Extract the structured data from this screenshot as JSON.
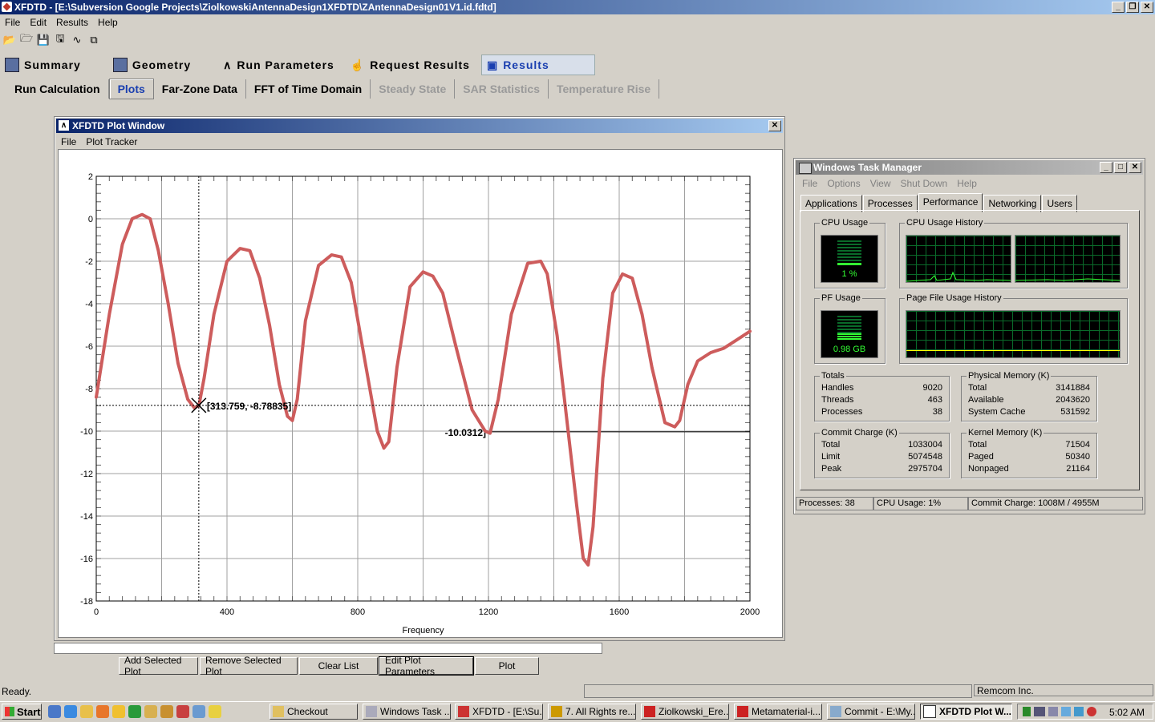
{
  "app": {
    "title": "XFDTD - [E:\\Subversion Google Projects\\ZiolkowskiAntennaDesign1XFDTD\\ZAntennaDesign01V1.id.fdtd]",
    "menus": [
      "File",
      "Edit",
      "Results",
      "Help"
    ],
    "toolbar_icons": [
      "open-icon",
      "open-folder-icon",
      "save-icon",
      "save-as-icon",
      "curve-icon",
      "copy-icon"
    ]
  },
  "main_tabs": [
    {
      "label": "Summary",
      "icon": "summary-icon"
    },
    {
      "label": "Geometry",
      "icon": "geometry-icon"
    },
    {
      "label": "Run Parameters",
      "icon": "run-parameters-icon"
    },
    {
      "label": "Request Results",
      "icon": "request-results-icon"
    },
    {
      "label": "Results",
      "icon": "results-icon",
      "active": true
    }
  ],
  "sub_tabs": [
    {
      "label": "Run Calculation",
      "state": "normal"
    },
    {
      "label": "Plots",
      "state": "active"
    },
    {
      "label": "Far-Zone Data",
      "state": "normal"
    },
    {
      "label": "FFT of Time Domain",
      "state": "normal"
    },
    {
      "label": "Steady State",
      "state": "disabled"
    },
    {
      "label": "SAR Statistics",
      "state": "disabled"
    },
    {
      "label": "Temperature Rise",
      "state": "disabled"
    }
  ],
  "plot_window": {
    "title": "XFDTD Plot Window",
    "menus": [
      "File",
      "Plot Tracker"
    ],
    "tracker_label": "[313.759, -8.78835]",
    "marker_label": "-10.0312]"
  },
  "chart_data": {
    "type": "line",
    "xlabel": "Frequency",
    "ylabel": "",
    "xlim": [
      0,
      2000
    ],
    "ylim": [
      -18,
      2
    ],
    "xticks": [
      0,
      400,
      800,
      1200,
      1600,
      2000
    ],
    "yticks": [
      2,
      0,
      -2,
      -4,
      -6,
      -8,
      -10,
      -12,
      -14,
      -16,
      -18
    ],
    "grid": true,
    "line_color": "#cd5c5c",
    "cursor": {
      "x": 313.759,
      "y": -8.78835
    },
    "marker_line": {
      "x": 1200,
      "y": -10.0312
    },
    "series": [
      {
        "x": [
          0,
          40,
          80,
          110,
          140,
          165,
          190,
          220,
          250,
          280,
          300,
          314,
          330,
          360,
          400,
          440,
          470,
          500,
          530,
          560,
          585,
          600,
          615,
          640,
          680,
          720,
          750,
          780,
          820,
          860,
          880,
          895,
          920,
          960,
          1000,
          1030,
          1060,
          1100,
          1150,
          1190,
          1205,
          1230,
          1270,
          1320,
          1360,
          1380,
          1410,
          1440,
          1470,
          1490,
          1505,
          1520,
          1550,
          1580,
          1610,
          1640,
          1670,
          1700,
          1740,
          1770,
          1785,
          1810,
          1840,
          1880,
          1920,
          1960,
          2000
        ],
        "y": [
          -8.4,
          -4.5,
          -1.2,
          0.0,
          0.2,
          0.0,
          -1.5,
          -4.0,
          -6.8,
          -8.5,
          -8.9,
          -8.8,
          -7.5,
          -4.5,
          -2.0,
          -1.4,
          -1.5,
          -2.8,
          -5.0,
          -7.8,
          -9.3,
          -9.5,
          -8.5,
          -4.8,
          -2.2,
          -1.7,
          -1.8,
          -3.0,
          -6.5,
          -10.0,
          -10.8,
          -10.5,
          -7.0,
          -3.2,
          -2.5,
          -2.7,
          -3.5,
          -6.0,
          -9.0,
          -10.0,
          -10.1,
          -8.5,
          -4.5,
          -2.1,
          -2.0,
          -2.6,
          -5.5,
          -9.5,
          -13.5,
          -16.0,
          -16.3,
          -14.5,
          -7.5,
          -3.5,
          -2.6,
          -2.8,
          -4.5,
          -7.0,
          -9.6,
          -9.8,
          -9.5,
          -7.8,
          -6.7,
          -6.3,
          -6.1,
          -5.7,
          -5.3
        ]
      }
    ]
  },
  "buttons": {
    "add": "Add Selected Plot",
    "remove": "Remove Selected Plot",
    "clear": "Clear List",
    "edit": "Edit Plot Parameters",
    "plot": "Plot"
  },
  "status": {
    "left": "Ready.",
    "right": "Remcom Inc."
  },
  "task_manager": {
    "title": "Windows Task Manager",
    "menus": [
      "File",
      "Options",
      "View",
      "Shut Down",
      "Help"
    ],
    "tabs": [
      "Applications",
      "Processes",
      "Performance",
      "Networking",
      "Users"
    ],
    "active_tab": "Performance",
    "cpu_usage_label": "CPU Usage",
    "cpu_usage_value": "1 %",
    "cpu_history_label": "CPU Usage History",
    "pf_usage_label": "PF Usage",
    "pf_usage_value": "0.98 GB",
    "pf_history_label": "Page File Usage History",
    "totals": {
      "label": "Totals",
      "rows": [
        [
          "Handles",
          "9020"
        ],
        [
          "Threads",
          "463"
        ],
        [
          "Processes",
          "38"
        ]
      ]
    },
    "physical": {
      "label": "Physical Memory (K)",
      "rows": [
        [
          "Total",
          "3141884"
        ],
        [
          "Available",
          "2043620"
        ],
        [
          "System Cache",
          "531592"
        ]
      ]
    },
    "commit": {
      "label": "Commit Charge (K)",
      "rows": [
        [
          "Total",
          "1033004"
        ],
        [
          "Limit",
          "5074548"
        ],
        [
          "Peak",
          "2975704"
        ]
      ]
    },
    "kernel": {
      "label": "Kernel Memory (K)",
      "rows": [
        [
          "Total",
          "71504"
        ],
        [
          "Paged",
          "50340"
        ],
        [
          "Nonpaged",
          "21164"
        ]
      ]
    },
    "status": [
      "Processes: 38",
      "CPU Usage: 1%",
      "Commit Charge: 1008M / 4955M"
    ]
  },
  "taskbar": {
    "start": "Start",
    "quicklaunch": [
      "desktop-icon",
      "ie-icon",
      "explorer-icon",
      "firefox-icon",
      "media-icon",
      "green-app-icon",
      "folder-icon",
      "tool-icon",
      "link-icon",
      "box-icon",
      "pencil-icon"
    ],
    "tasks": [
      {
        "label": "Checkout",
        "active": false
      },
      {
        "label": "Windows Task ...",
        "active": false
      },
      {
        "label": "XFDTD - [E:\\Su...",
        "active": false
      },
      {
        "label": "7. All Rights re...",
        "active": false
      },
      {
        "label": "Ziolkowski_Ere...",
        "active": false
      },
      {
        "label": "Metamaterial-i...",
        "active": false
      },
      {
        "label": "Commit - E:\\My...",
        "active": false
      },
      {
        "label": "XFDTD Plot W...",
        "active": true
      }
    ],
    "clock": "5:02 AM"
  }
}
